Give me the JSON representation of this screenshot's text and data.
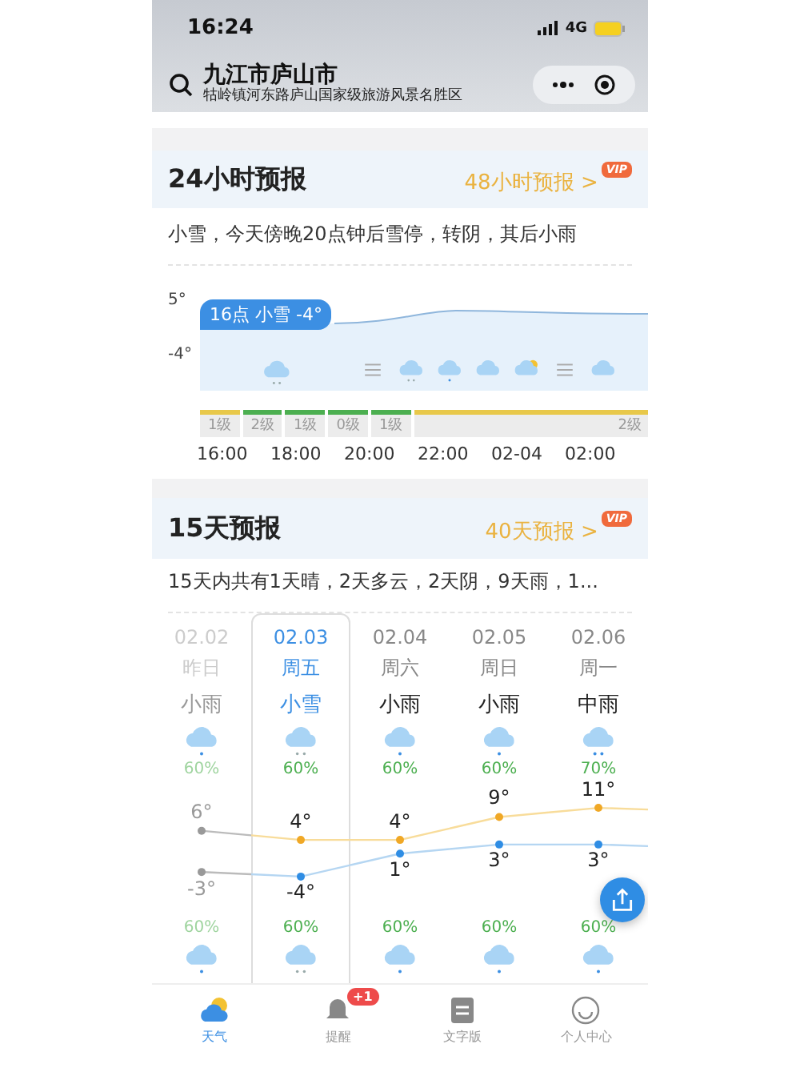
{
  "status_bar": {
    "time": "16:24",
    "network": "4G"
  },
  "header": {
    "title": "九江市庐山市",
    "subtitle": "牯岭镇河东路庐山国家级旅游风景名胜区"
  },
  "hourly": {
    "title": "24小时预报",
    "link": "48小时预报 >",
    "badge": "VIP",
    "summary": "小雪，今天傍晚20点钟后雪停，转阴，其后小雨",
    "y_labels": [
      "5°",
      "-4°"
    ],
    "callout": "16点 小雪 -4°",
    "icons": [
      {
        "kind": "snow"
      },
      {
        "kind": "haze"
      },
      {
        "kind": "snow"
      },
      {
        "kind": "rain"
      },
      {
        "kind": "cloud"
      },
      {
        "kind": "partly"
      },
      {
        "kind": "haze"
      },
      {
        "kind": "cloud"
      }
    ],
    "wind": [
      {
        "label": "1级",
        "color": "#e8c84a"
      },
      {
        "label": "2级",
        "color": "#4caf50"
      },
      {
        "label": "1级",
        "color": "#4caf50"
      },
      {
        "label": "0级",
        "color": "#4caf50"
      },
      {
        "label": "1级",
        "color": "#4caf50"
      },
      {
        "label": "2级",
        "color": "#e8c84a"
      }
    ],
    "times": [
      "16:00",
      "18:00",
      "20:00",
      "22:00",
      "02-04",
      "02:00"
    ]
  },
  "daily": {
    "title": "15天预报",
    "link": "40天预报 >",
    "badge": "VIP",
    "summary": "15天内共有1天晴，2天多云，2天阴，9天雨，1...",
    "days": [
      {
        "date": "02.02",
        "weekday": "昨日",
        "weather": "小雨",
        "day_icon": {
          "kind": "rain"
        },
        "precip": "60%",
        "high": "6°",
        "low": "-3°",
        "precip_night": "60%",
        "night_icon": {
          "kind": "rain"
        },
        "past": true,
        "selected": false
      },
      {
        "date": "02.03",
        "weekday": "周五",
        "weather": "小雪",
        "day_icon": {
          "kind": "snow"
        },
        "precip": "60%",
        "high": "4°",
        "low": "-4°",
        "precip_night": "60%",
        "night_icon": {
          "kind": "snow"
        },
        "past": false,
        "selected": true
      },
      {
        "date": "02.04",
        "weekday": "周六",
        "weather": "小雨",
        "day_icon": {
          "kind": "rain"
        },
        "precip": "60%",
        "high": "4°",
        "low": "1°",
        "precip_night": "60%",
        "night_icon": {
          "kind": "rain"
        },
        "past": false,
        "selected": false
      },
      {
        "date": "02.05",
        "weekday": "周日",
        "weather": "小雨",
        "day_icon": {
          "kind": "rain"
        },
        "precip": "60%",
        "high": "9°",
        "low": "3°",
        "precip_night": "60%",
        "night_icon": {
          "kind": "rain"
        },
        "past": false,
        "selected": false
      },
      {
        "date": "02.06",
        "weekday": "周一",
        "weather": "中雨",
        "day_icon": {
          "kind": "heavy"
        },
        "precip": "70%",
        "high": "11°",
        "low": "3°",
        "precip_night": "60%",
        "night_icon": {
          "kind": "rain"
        },
        "past": false,
        "selected": false
      }
    ]
  },
  "tab_bar": [
    {
      "label": "天气",
      "kind": "weather",
      "selected": true
    },
    {
      "label": "提醒",
      "kind": "bell",
      "selected": false,
      "badge": "+1"
    },
    {
      "label": "文字版",
      "kind": "doc",
      "selected": false
    },
    {
      "label": "个人中心",
      "kind": "face",
      "selected": false
    }
  ]
}
